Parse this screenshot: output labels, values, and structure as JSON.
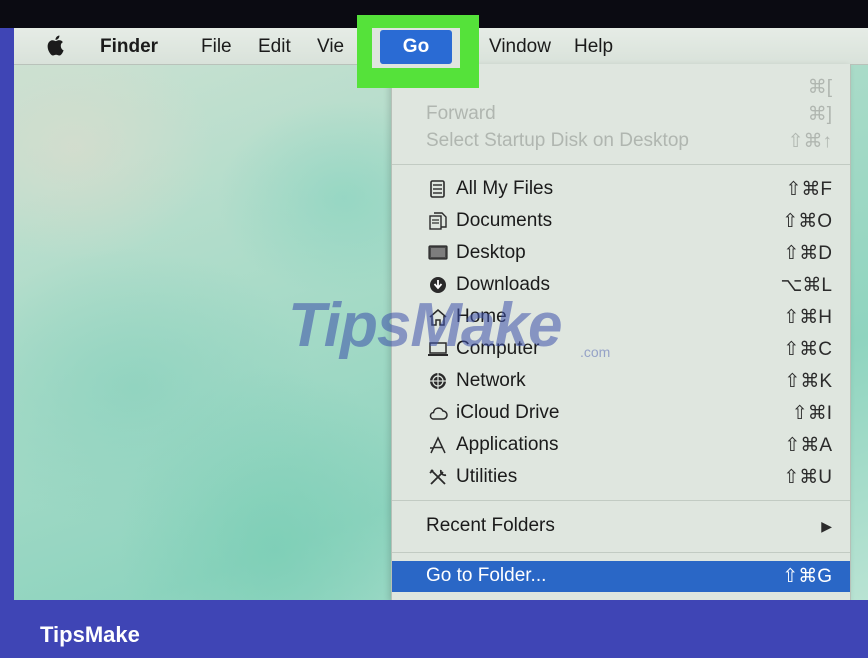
{
  "menubar": {
    "apple_icon": "apple-logo-icon",
    "items": [
      "Finder",
      "File",
      "Edit",
      "View",
      "Go",
      "Window",
      "Help"
    ],
    "visible_text": {
      "view": "Vie",
      "window": "Vindow"
    }
  },
  "go_menu": {
    "title": "Go",
    "disabled_items": [
      {
        "label": "",
        "shortcut": "⌘["
      },
      {
        "label": "Forward",
        "shortcut": "⌘]"
      },
      {
        "label": "Select Startup Disk on Desktop",
        "shortcut": "⇧⌘↑"
      }
    ],
    "places": [
      {
        "label": "All My Files",
        "shortcut": "⇧⌘F",
        "icon": "all-files-icon"
      },
      {
        "label": "Documents",
        "shortcut": "⇧⌘O",
        "icon": "documents-icon"
      },
      {
        "label": "Desktop",
        "shortcut": "⇧⌘D",
        "icon": "desktop-icon"
      },
      {
        "label": "Downloads",
        "shortcut": "⌥⌘L",
        "icon": "downloads-icon"
      },
      {
        "label": "Home",
        "shortcut": "⇧⌘H",
        "icon": "home-icon"
      },
      {
        "label": "Computer",
        "shortcut": "⇧⌘C",
        "icon": "computer-icon"
      },
      {
        "label": "Network",
        "shortcut": "⇧⌘K",
        "icon": "network-icon"
      },
      {
        "label": "iCloud Drive",
        "shortcut": "⇧⌘I",
        "icon": "cloud-icon"
      },
      {
        "label": "Applications",
        "shortcut": "⇧⌘A",
        "icon": "applications-icon"
      },
      {
        "label": "Utilities",
        "shortcut": "⇧⌘U",
        "icon": "utilities-icon"
      }
    ],
    "recent_folders": {
      "label": "Recent Folders",
      "indicator": "▶"
    },
    "go_to_folder": {
      "label": "Go to Folder...",
      "shortcut": "⇧⌘G"
    }
  },
  "watermark": {
    "text": "TipsMake",
    "suffix": ".com"
  },
  "brand": "TipsMake",
  "colors": {
    "highlight": "#55e23a",
    "selection": "#2a67c6",
    "frame": "#3f45b5"
  }
}
